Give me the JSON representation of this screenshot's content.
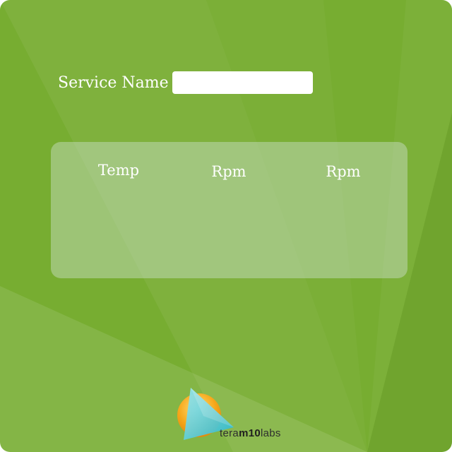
{
  "form": {
    "service_name_label": "Service Name",
    "service_name_value": "",
    "service_name_placeholder": ""
  },
  "table": {
    "columns": [
      "Temp",
      "Rpm",
      "Rpm"
    ]
  },
  "branding": {
    "logo_icon": "triangle-over-sphere-icon",
    "logo_text_part1": "tera",
    "logo_text_part2": "m10",
    "logo_text_part3": "labs"
  },
  "colors": {
    "background": "#77ad31",
    "input_background": "#ffffff",
    "text": "#ffffff"
  }
}
